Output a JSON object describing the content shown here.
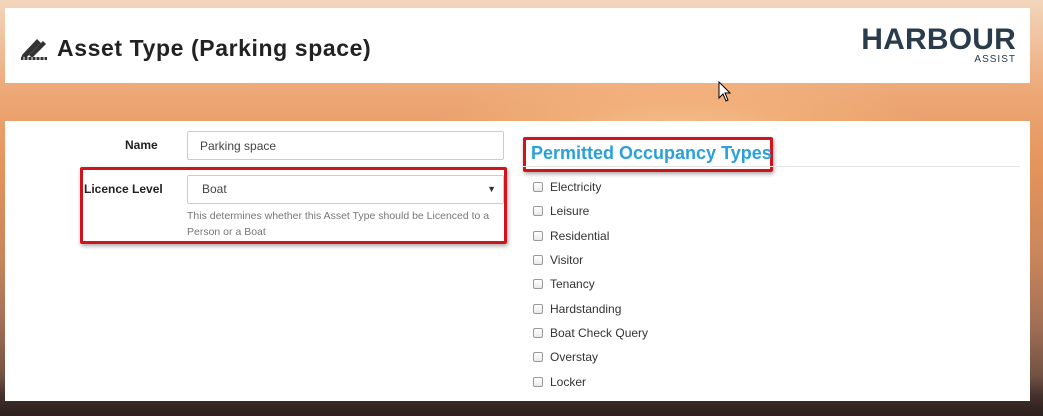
{
  "header": {
    "title": "Asset Type (Parking space)",
    "title_icon": "drafting-pencil-icon",
    "logo": {
      "main": "HARBOUR",
      "sub": "ASSIST"
    }
  },
  "form": {
    "name_label": "Name",
    "name_value": "Parking space",
    "licence_label": "Licence Level",
    "licence_value": "Boat",
    "licence_help": "This determines whether this Asset Type should be Licenced to a Person or a Boat"
  },
  "occupancy": {
    "title": "Permitted Occupancy Types",
    "types": [
      "Electricity",
      "Leisure",
      "Residential",
      "Visitor",
      "Tenancy",
      "Hardstanding",
      "Boat Check Query",
      "Overstay",
      "Locker"
    ]
  },
  "colors": {
    "accent": "#2aa0d8",
    "highlight": "#d0141c",
    "logo": "#2a3b4c"
  }
}
